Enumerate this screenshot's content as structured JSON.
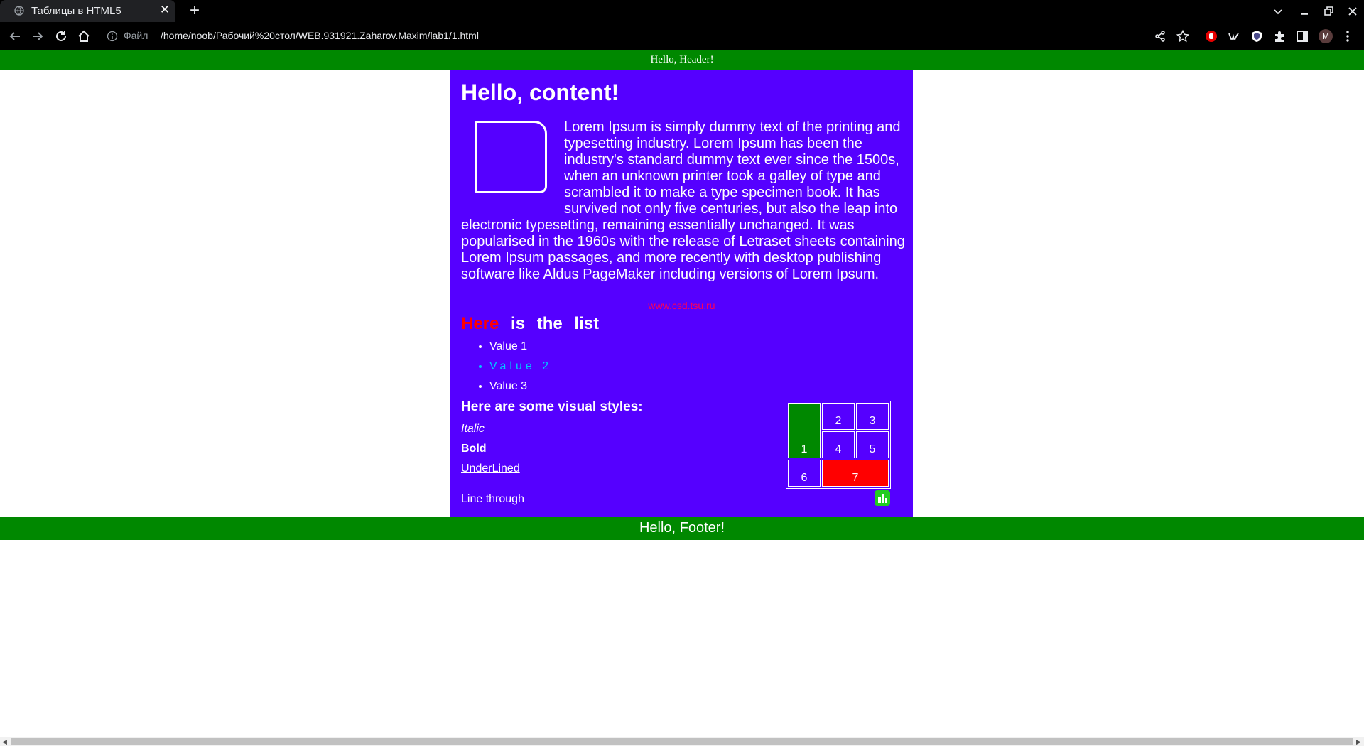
{
  "browser": {
    "tab_title": "Таблицы в HTML5",
    "close_glyph": "✕",
    "new_tab_glyph": "+",
    "omnibox_label": "Файл",
    "url": "/home/noob/Рабочий%20стол/WEB.931921.Zaharov.Maxim/lab1/1.html",
    "avatar_initial": "M"
  },
  "page": {
    "header": "Hello, Header!",
    "content_title": "Hello, content!",
    "lorem": "Lorem Ipsum is simply dummy text of the printing and typesetting industry. Lorem Ipsum has been the industry's standard dummy text ever since the 1500s, when an unknown printer took a galley of type and scrambled it to make a type specimen book. It has survived not only five centuries, but also the leap into electronic typesetting, remaining essentially unchanged. It was popularised in the 1960s with the release of Letraset sheets containing Lorem Ipsum passages, and more recently with desktop publishing software like Aldus PageMaker including versions of Lorem Ipsum.",
    "link": "www.csd.tsu.ru",
    "list_heading_highlight": "Here",
    "list_heading_rest": "is the list",
    "list_items": [
      "Value 1",
      "Value 2",
      "Value 3"
    ],
    "visual_heading": "Here are some visual styles:",
    "styles": {
      "italic": "Italic",
      "bold": "Bold",
      "underline": "UnderLined",
      "strike": "Line through"
    },
    "table_cells": [
      "1",
      "2",
      "3",
      "4",
      "5",
      "6",
      "7"
    ],
    "footer": "Hello, Footer!"
  },
  "colors": {
    "header_footer_bg": "#008800",
    "content_bg": "#5500ff",
    "highlight_red": "#ff0000",
    "list_item_2": "#00c8ff",
    "link": "#ff0055"
  }
}
